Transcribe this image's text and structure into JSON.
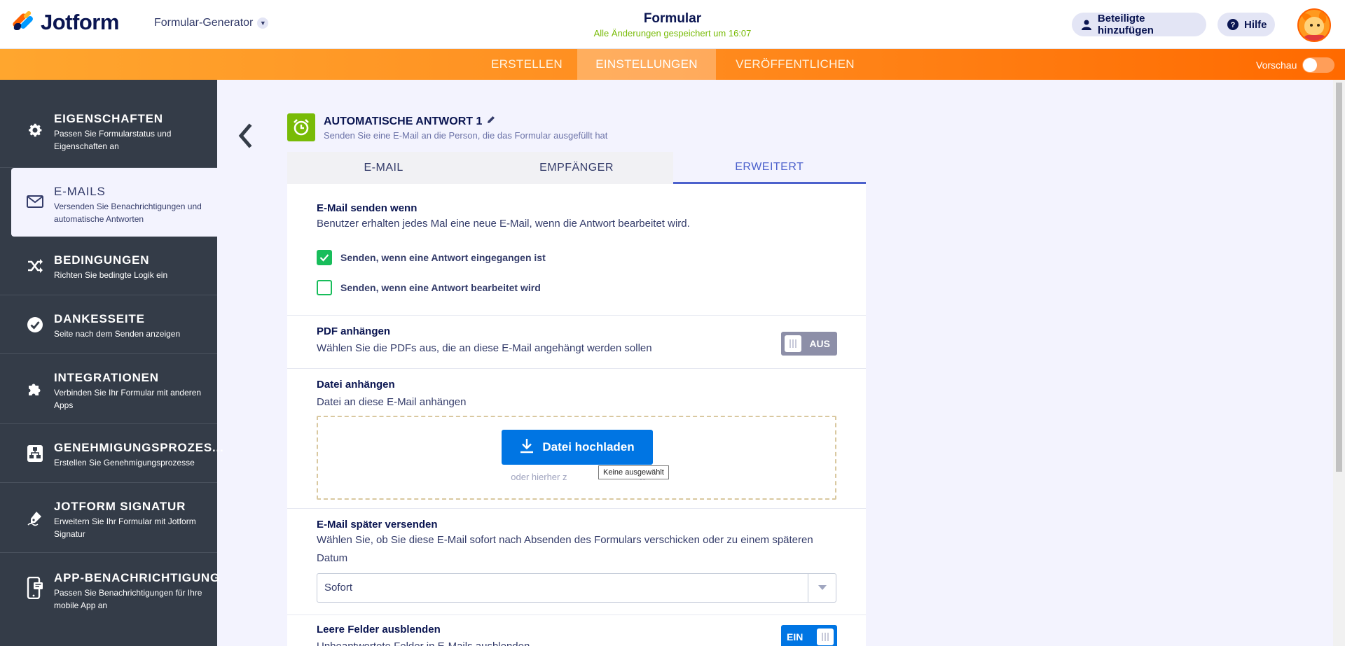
{
  "header": {
    "brand": "Jotform",
    "builder_switch": "Formular-Generator",
    "form_title": "Formular",
    "save_status": "Alle Änderungen gespeichert um 16:07",
    "invite_label": "Beteiligte hinzufügen",
    "help_label": "Hilfe"
  },
  "nav": {
    "tabs": [
      "ERSTELLEN",
      "EINSTELLUNGEN",
      "VERÖFFENTLICHEN"
    ],
    "active_tab": "EINSTELLUNGEN",
    "preview_label": "Vorschau"
  },
  "sidebar": {
    "items": [
      {
        "title": "EIGENSCHAFTEN",
        "desc": "Passen Sie Formularstatus und Eigenschaften an",
        "icon": "gear-icon"
      },
      {
        "title": "E-MAILS",
        "desc": "Versenden Sie Benachrichtigungen und automatische Antworten",
        "icon": "envelope-icon",
        "active": true
      },
      {
        "title": "BEDINGUNGEN",
        "desc": "Richten Sie bedingte Logik ein",
        "icon": "shuffle-icon"
      },
      {
        "title": "DANKESSEITE",
        "desc": "Seite nach dem Senden anzeigen",
        "icon": "check-circle-icon"
      },
      {
        "title": "INTEGRATIONEN",
        "desc": "Verbinden Sie Ihr Formular mit anderen Apps",
        "icon": "puzzle-icon"
      },
      {
        "title": "GENEHMIGUNGSPROZES...",
        "desc": "Erstellen Sie Genehmigungsprozesse",
        "icon": "flow-icon"
      },
      {
        "title": "JOTFORM SIGNATUR",
        "desc": "Erweitern Sie Ihr Formular mit Jotform Signatur",
        "icon": "pen-icon"
      },
      {
        "title": "APP-BENACHRICHTIGUNG",
        "desc": "Passen Sie Benachrichtigungen für Ihre mobile App an",
        "icon": "mobile-icon"
      }
    ]
  },
  "panel": {
    "title": "AUTOMATISCHE ANTWORT 1",
    "subtitle": "Senden Sie eine E-Mail an die Person, die das Formular ausgefüllt hat",
    "tabs": [
      "E-MAIL",
      "EMPFÄNGER",
      "ERWEITERT"
    ],
    "active_tab": "ERWEITERT"
  },
  "sections": {
    "send_when": {
      "title": "E-Mail senden wenn",
      "desc": "Benutzer erhalten jedes Mal eine neue E-Mail, wenn die Antwort bearbeitet wird.",
      "options": [
        {
          "label": "Senden, wenn eine Antwort eingegangen ist",
          "checked": true
        },
        {
          "label": "Senden, wenn eine Antwort bearbeitet wird",
          "checked": false
        }
      ]
    },
    "pdf": {
      "title": "PDF anhängen",
      "desc": "Wählen Sie die PDFs aus, die an diese E-Mail angehängt werden sollen",
      "toggle_label": "AUS",
      "enabled": false
    },
    "file": {
      "title": "Datei anhängen",
      "desc": "Datei an diese E-Mail anhängen",
      "upload_label": "Datei hochladen",
      "hint_left": "oder hierher z",
      "hint_right": "n",
      "tooltip": "Keine ausgewählt"
    },
    "later": {
      "title": "E-Mail später versenden",
      "desc": "Wählen Sie, ob Sie diese E-Mail sofort nach Absenden des Formulars verschicken oder zu einem späteren Datum",
      "selected": "Sofort"
    },
    "hide_empty": {
      "title": "Leere Felder ausblenden",
      "desc": "Unbeantwortete Felder in E-Mails ausblenden",
      "toggle_label": "EIN",
      "enabled": true
    }
  },
  "colors": {
    "accent_orange": "#ff6100",
    "primary_blue": "#0075e3",
    "sidebar_bg": "#343c48",
    "success_green": "#18bd5b",
    "panel_icon_green": "#78bb07"
  }
}
